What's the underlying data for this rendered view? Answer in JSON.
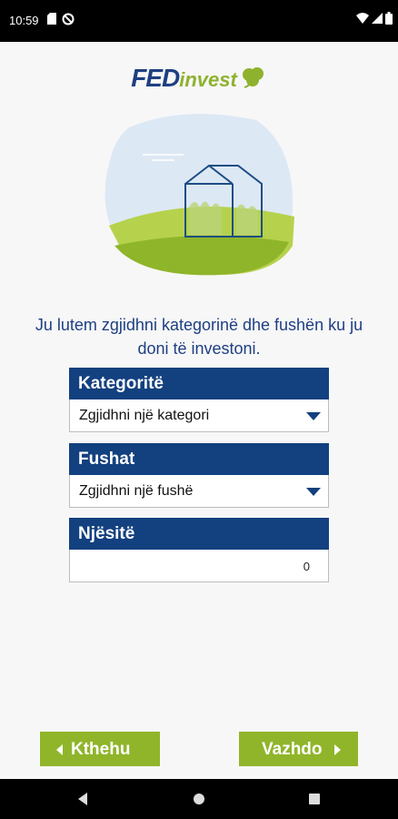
{
  "status_bar": {
    "time": "10:59",
    "icons": [
      "sd-card-icon",
      "no-disturb-icon",
      "wifi-icon",
      "signal-icon",
      "battery-icon"
    ]
  },
  "logo": {
    "fed": "FED",
    "invest": "invest"
  },
  "prompt": "Ju lutem zgjidhni kategorinë dhe fushën ku ju doni të investoni.",
  "fields": {
    "categories": {
      "label": "Kategoritë",
      "value": "Zgjidhni një kategori"
    },
    "fields": {
      "label": "Fushat",
      "value": "Zgjidhni një fushë"
    },
    "units": {
      "label": "Njësitë",
      "value": "0"
    }
  },
  "buttons": {
    "back": "Kthehu",
    "next": "Vazhdo"
  },
  "colors": {
    "primary": "#13407f",
    "accent": "#90b52a",
    "brand_blue": "#1e3f82",
    "background": "#f7f7f7"
  },
  "nav_icons": [
    "back-icon",
    "home-icon",
    "recents-icon"
  ]
}
